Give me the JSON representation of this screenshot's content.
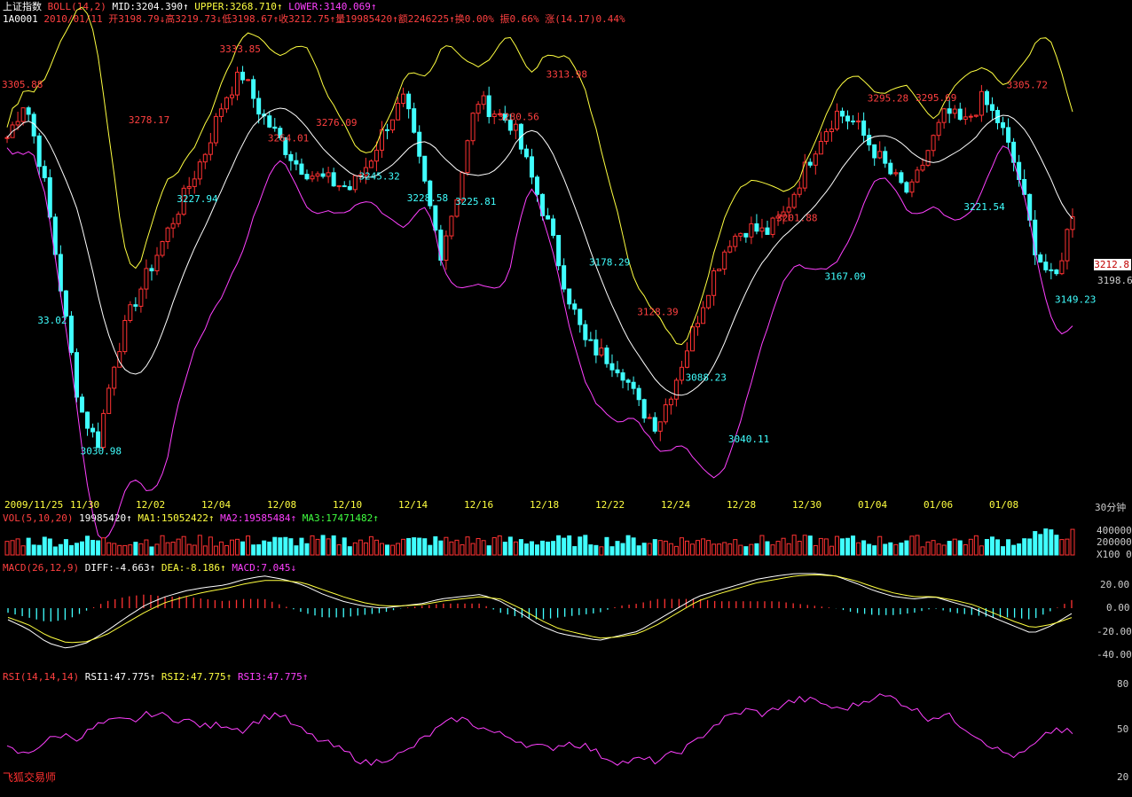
{
  "header": {
    "title": "上证指数",
    "indicator": "BOLL(14,2)",
    "mid": "MID:3204.390↑",
    "upper": "UPPER:3268.710↑",
    "lower": "LOWER:3140.069↑",
    "code": "1A0001",
    "quote": "2010/01/11 开3198.79↓高3219.73↓低3198.67↑收3212.75↑量19985420↑额2246225↑换0.00% 振0.66% 涨(14.17)0.44%"
  },
  "vol_header": {
    "name": "VOL(5,10,20)",
    "value": "19985420↑",
    "ma1": "MA1:15052422↑",
    "ma2": "MA2:19585484↑",
    "ma3": "MA3:17471482↑"
  },
  "macd_header": {
    "name": "MACD(26,12,9)",
    "diff": "DIFF:-4.663↑",
    "dea": "DEA:-8.186↑",
    "macd": "MACD:7.045↓"
  },
  "rsi_header": {
    "name": "RSI(14,14,14)",
    "rsi1": "RSI1:47.775↑",
    "rsi2": "RSI2:47.775↑",
    "rsi3": "RSI3:47.775↑"
  },
  "right_axis": {
    "price_tag": "3212.8",
    "price_low": "3198.6",
    "period": "30分钟",
    "vol_ticks": [
      "400000",
      "200000",
      "X100 0"
    ],
    "macd_ticks": [
      "20.00",
      "0.00",
      "-20.00",
      "-40.00"
    ],
    "rsi_ticks": [
      "80",
      "50",
      "20"
    ]
  },
  "brand": "飞狐交易师",
  "colors": {
    "up": "#ff3232",
    "down": "#40ffff",
    "mid": "#ffffff",
    "upper": "#ffff40",
    "lower": "#ff40ff"
  },
  "chart_data": {
    "type": "candlestick",
    "x_labels": [
      "2009/11/25",
      "11/30",
      "12/02",
      "12/04",
      "12/08",
      "12/10",
      "12/14",
      "12/16",
      "12/18",
      "12/22",
      "12/24",
      "12/28",
      "12/30",
      "01/04",
      "01/06",
      "01/08"
    ],
    "price_annotations": [
      {
        "label": "3305.88",
        "value": 3305.88,
        "kind": "high"
      },
      {
        "label": "33.02",
        "value": 3133.02,
        "kind": "low"
      },
      {
        "label": "3030.98",
        "value": 3030.98,
        "kind": "low"
      },
      {
        "label": "3278.17",
        "value": 3278.17,
        "kind": "high"
      },
      {
        "label": "3227.94",
        "value": 3227.94,
        "kind": "low"
      },
      {
        "label": "3333.85",
        "value": 3333.85,
        "kind": "high"
      },
      {
        "label": "3264.01",
        "value": 3264.01,
        "kind": "high"
      },
      {
        "label": "3276.09",
        "value": 3276.09,
        "kind": "high"
      },
      {
        "label": "3245.32",
        "value": 3245.32,
        "kind": "low"
      },
      {
        "label": "3228.58",
        "value": 3228.58,
        "kind": "low"
      },
      {
        "label": "3225.81",
        "value": 3225.81,
        "kind": "low"
      },
      {
        "label": "3280.56",
        "value": 3280.56,
        "kind": "high"
      },
      {
        "label": "3313.98",
        "value": 3313.98,
        "kind": "high"
      },
      {
        "label": "3178.29",
        "value": 3178.29,
        "kind": "low"
      },
      {
        "label": "3128.39",
        "value": 3128.39,
        "kind": "high"
      },
      {
        "label": "3088.23",
        "value": 3088.23,
        "kind": "low"
      },
      {
        "label": "3040.11",
        "value": 3040.11,
        "kind": "low"
      },
      {
        "label": "3201.88",
        "value": 3201.88,
        "kind": "high"
      },
      {
        "label": "3167.09",
        "value": 3167.09,
        "kind": "low"
      },
      {
        "label": "3295.28",
        "value": 3295.28,
        "kind": "high"
      },
      {
        "label": "3295.69",
        "value": 3295.69,
        "kind": "high"
      },
      {
        "label": "3221.54",
        "value": 3221.54,
        "kind": "low"
      },
      {
        "label": "3305.72",
        "value": 3305.72,
        "kind": "high"
      },
      {
        "label": "3149.23",
        "value": 3149.23,
        "kind": "low"
      }
    ],
    "close_path": [
      3270,
      3300,
      3240,
      3150,
      3060,
      3030,
      3100,
      3140,
      3170,
      3200,
      3230,
      3260,
      3300,
      3320,
      3290,
      3270,
      3250,
      3240,
      3235,
      3230,
      3250,
      3280,
      3300,
      3240,
      3180,
      3230,
      3300,
      3290,
      3280,
      3240,
      3200,
      3150,
      3110,
      3100,
      3090,
      3060,
      3045,
      3080,
      3120,
      3160,
      3190,
      3200,
      3195,
      3210,
      3240,
      3270,
      3290,
      3280,
      3260,
      3240,
      3225,
      3260,
      3290,
      3280,
      3300,
      3280,
      3240,
      3180,
      3155,
      3212.75
    ],
    "rsi_path": [
      38,
      34,
      42,
      47,
      45,
      53,
      56,
      56,
      61,
      58,
      56,
      52,
      54,
      50,
      57,
      61,
      52,
      45,
      40,
      34,
      28,
      32,
      35,
      44,
      52,
      58,
      53,
      48,
      45,
      40,
      38,
      42,
      40,
      33,
      29,
      31,
      30,
      35,
      41,
      52,
      59,
      63,
      60,
      67,
      70,
      68,
      63,
      66,
      72,
      71,
      65,
      58,
      60,
      52,
      44,
      36,
      33,
      41,
      51,
      47.775
    ],
    "macd_diff": [
      -10,
      -18,
      -30,
      -35,
      -30,
      -20,
      -8,
      3,
      10,
      15,
      18,
      20,
      25,
      28,
      25,
      20,
      12,
      6,
      2,
      0,
      2,
      4,
      8,
      10,
      12,
      6,
      -4,
      -15,
      -22,
      -25,
      -28,
      -24,
      -20,
      -10,
      0,
      10,
      15,
      20,
      25,
      28,
      30,
      30,
      28,
      22,
      15,
      10,
      8,
      10,
      5,
      0,
      -8,
      -15,
      -22,
      -15,
      -4.663
    ],
    "macd_dea": [
      -8,
      -14,
      -24,
      -30,
      -29,
      -23,
      -13,
      -3,
      5,
      10,
      14,
      17,
      21,
      24,
      24,
      22,
      16,
      10,
      5,
      2,
      2,
      3,
      6,
      8,
      10,
      8,
      0,
      -10,
      -18,
      -22,
      -26,
      -25,
      -22,
      -14,
      -4,
      6,
      12,
      17,
      22,
      25,
      28,
      29,
      28,
      24,
      18,
      13,
      10,
      10,
      7,
      3,
      -4,
      -11,
      -17,
      -14,
      -8.186
    ],
    "vol_max": 400000
  }
}
